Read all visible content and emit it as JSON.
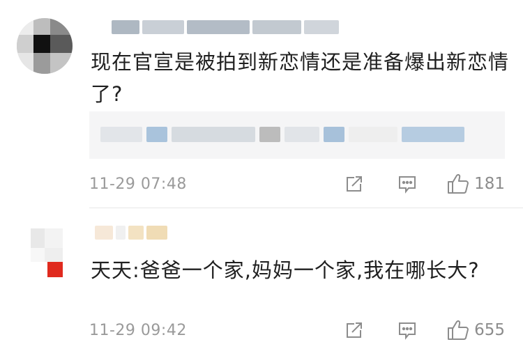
{
  "comments": [
    {
      "text": "现在官宣是被拍到新恋情还是准备爆出新恋情了?",
      "timestamp": "11-29 07:48",
      "likes": "181"
    },
    {
      "text": "天天:爸爸一个家,妈妈一个家,我在哪长大?",
      "timestamp": "11-29 09:42",
      "likes": "655"
    }
  ],
  "icons": {
    "share": "share-icon",
    "comment": "comment-icon",
    "like": "thumbs-up-icon"
  },
  "colors": {
    "meta_text": "#9a9a9a",
    "reply_bg": "#f5f5f6",
    "icon_stroke": "#8c8c8c"
  }
}
